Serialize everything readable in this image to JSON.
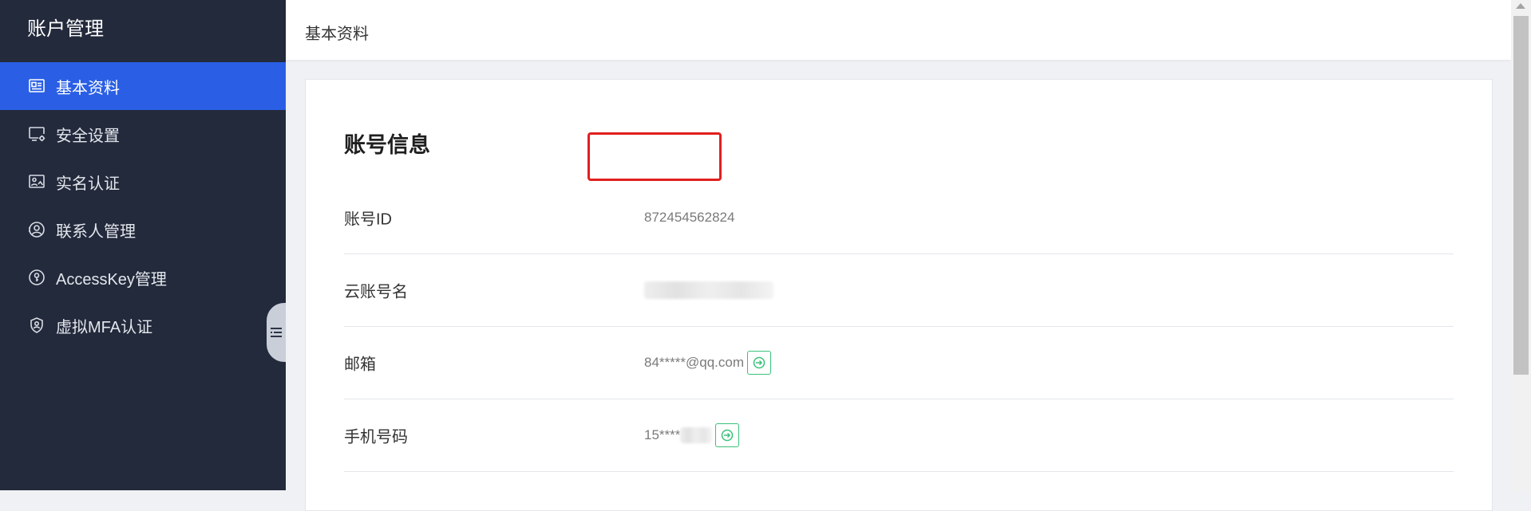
{
  "sidebar": {
    "title": "账户管理",
    "items": [
      {
        "label": "基本资料",
        "icon": "profile-card-icon",
        "active": true
      },
      {
        "label": "安全设置",
        "icon": "monitor-gear-icon",
        "active": false
      },
      {
        "label": "实名认证",
        "icon": "id-image-icon",
        "active": false
      },
      {
        "label": "联系人管理",
        "icon": "contact-person-icon",
        "active": false
      },
      {
        "label": "AccessKey管理",
        "icon": "key-bulb-icon",
        "active": false
      },
      {
        "label": "虚拟MFA认证",
        "icon": "shield-user-icon",
        "active": false
      }
    ]
  },
  "header": {
    "title": "基本资料"
  },
  "account": {
    "section_title": "账号信息",
    "rows": [
      {
        "label": "账号ID",
        "value": "872454562824"
      },
      {
        "label": "云账号名",
        "value": ""
      },
      {
        "label": "邮箱",
        "value": "84*****@qq.com",
        "action_icon": "edit-arrow-icon"
      },
      {
        "label": "手机号码",
        "value": "15****",
        "action_icon": "edit-arrow-icon"
      }
    ]
  },
  "colors": {
    "sidebar_bg": "#232a3c",
    "active_item": "#2a5fe5",
    "highlight": "#e21f1f",
    "edit_button": "#39c17a"
  }
}
